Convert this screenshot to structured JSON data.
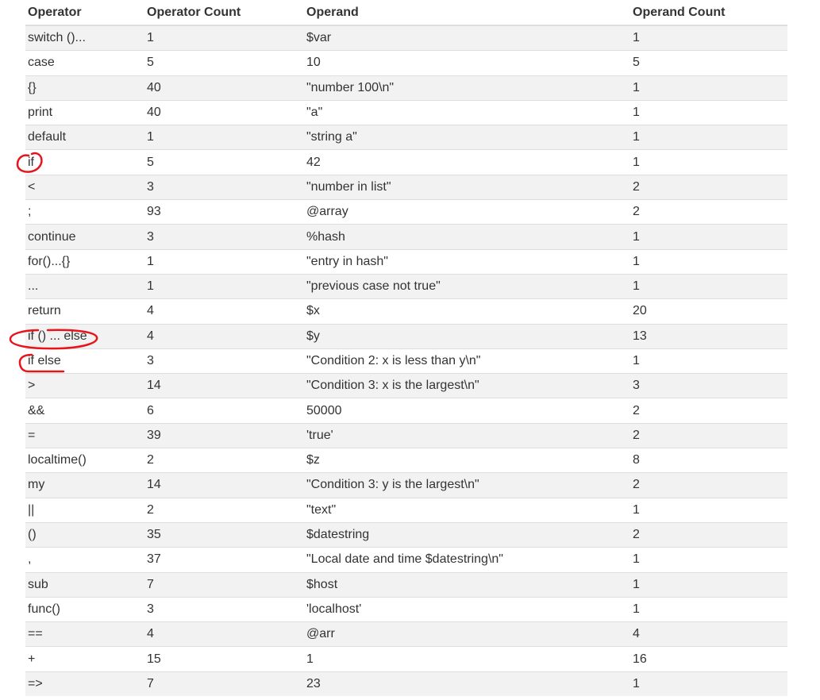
{
  "headers": [
    "Operator",
    "Operator Count",
    "Operand",
    "Operand Count"
  ],
  "rows": [
    [
      "switch ()...",
      "1",
      "$var",
      "1"
    ],
    [
      "case",
      "5",
      "10",
      "5"
    ],
    [
      "{}",
      "40",
      "\"number 100\\n\"",
      "1"
    ],
    [
      "print",
      "40",
      "\"a\"",
      "1"
    ],
    [
      "default",
      "1",
      "\"string a\"",
      "1"
    ],
    [
      "if",
      "5",
      "42",
      "1"
    ],
    [
      "<",
      "3",
      "\"number in list\"",
      "2"
    ],
    [
      ";",
      "93",
      "@array",
      "2"
    ],
    [
      "continue",
      "3",
      "%hash",
      "1"
    ],
    [
      "for()...{}",
      "1",
      "\"entry in hash\"",
      "1"
    ],
    [
      "...",
      "1",
      "\"previous case not true\"",
      "1"
    ],
    [
      "return",
      "4",
      "$x",
      "20"
    ],
    [
      "if () ... else",
      "4",
      "$y",
      "13"
    ],
    [
      "if else",
      "3",
      "\"Condition 2: x is less than y\\n\"",
      "1"
    ],
    [
      ">",
      "14",
      "\"Condition 3: x is the largest\\n\"",
      "3"
    ],
    [
      "&&",
      "6",
      "50000",
      "2"
    ],
    [
      "=",
      "39",
      "'true'",
      "2"
    ],
    [
      "localtime()",
      "2",
      "$z",
      "8"
    ],
    [
      "my",
      "14",
      "\"Condition 3: y is the largest\\n\"",
      "2"
    ],
    [
      "||",
      "2",
      "\"text\"",
      "1"
    ],
    [
      "()",
      "35",
      "$datestring",
      "2"
    ],
    [
      ",",
      "37",
      "\"Local date and time $datestring\\n\"",
      "1"
    ],
    [
      "sub",
      "7",
      "$host",
      "1"
    ],
    [
      "func()",
      "3",
      "'localhost'",
      "1"
    ],
    [
      "==",
      "4",
      "@arr",
      "4"
    ],
    [
      "+",
      "15",
      "1",
      "16"
    ],
    [
      "=>",
      "7",
      "23",
      "1"
    ]
  ],
  "annotation_color": "#e8141c"
}
